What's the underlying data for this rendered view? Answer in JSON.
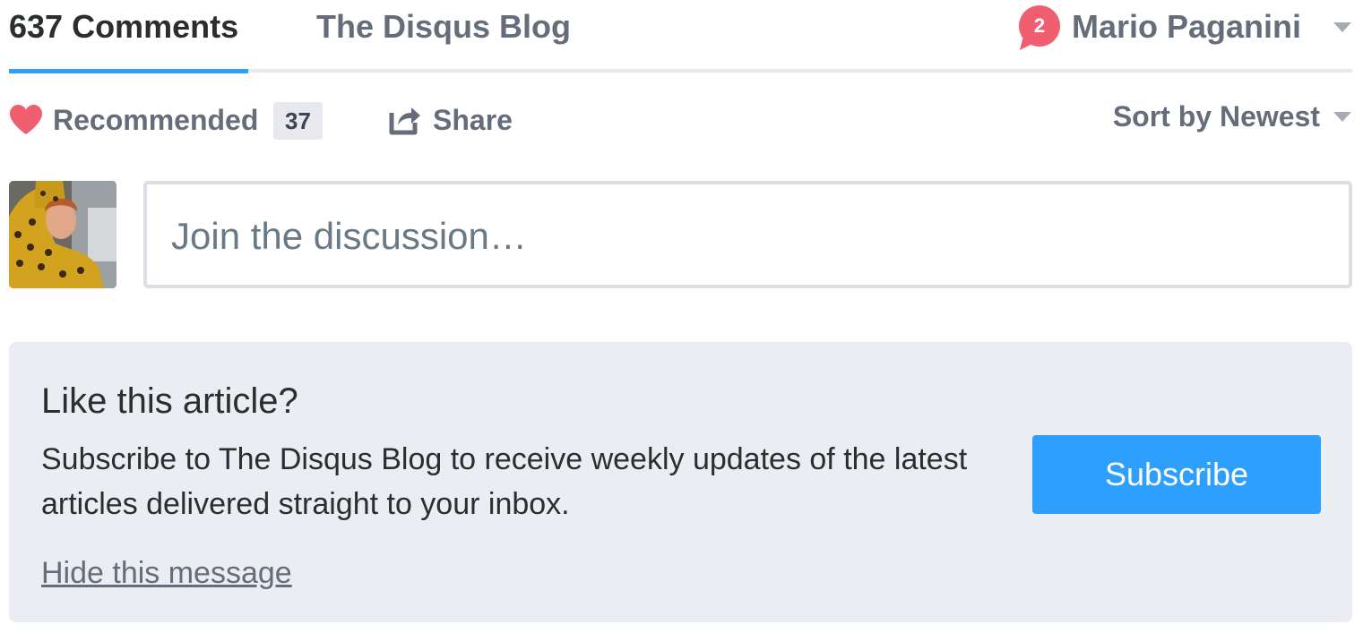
{
  "nav": {
    "tabs": [
      {
        "label": "637 Comments",
        "active": true
      },
      {
        "label": "The Disqus Blog",
        "active": false
      }
    ],
    "user": {
      "notification_count": "2",
      "name": "Mario Paganini"
    }
  },
  "toolbar": {
    "recommend": {
      "label": "Recommended",
      "count": "37",
      "icon": "heart-icon"
    },
    "share": {
      "label": "Share",
      "icon": "share-icon"
    },
    "sort": {
      "label": "Sort by Newest"
    }
  },
  "composer": {
    "placeholder": "Join the discussion…"
  },
  "subscribe_card": {
    "title": "Like this article?",
    "body": "Subscribe to The Disqus Blog to receive weekly updates of the latest articles delivered straight to your inbox.",
    "button_label": "Subscribe",
    "hide_label": "Hide this message"
  },
  "colors": {
    "accent": "#2e9fff",
    "heart": "#f05f70",
    "badge": "#f05f70",
    "muted_text": "#656c7a",
    "card_background": "#eaedf2"
  }
}
